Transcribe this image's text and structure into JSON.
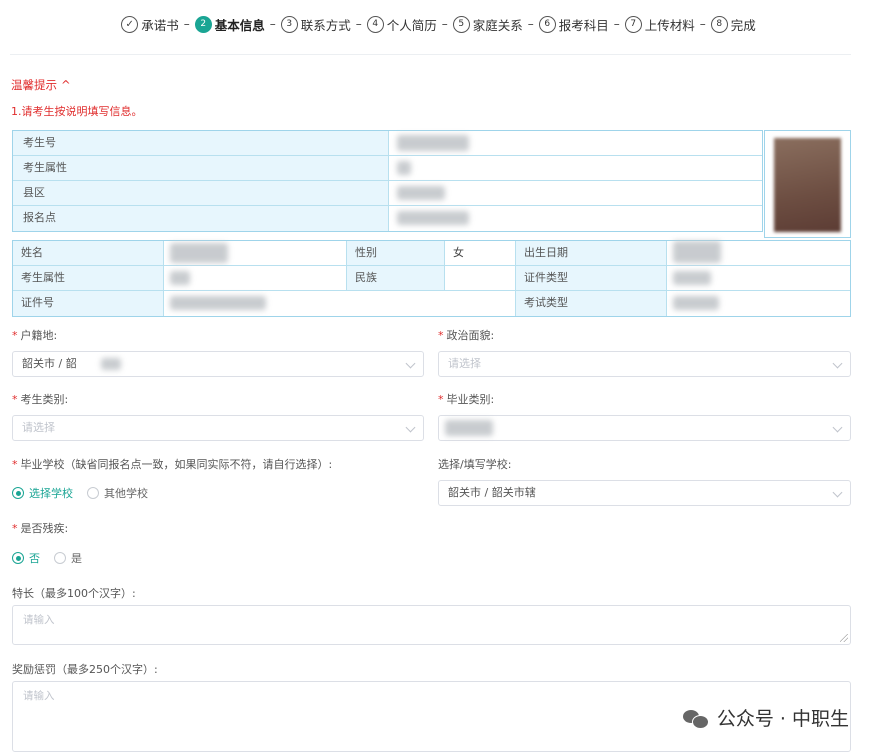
{
  "steps": [
    {
      "label": "承诺书",
      "state": "done",
      "mark": "✓"
    },
    {
      "label": "基本信息",
      "state": "active",
      "mark": "2"
    },
    {
      "label": "联系方式",
      "state": "todo",
      "mark": "3"
    },
    {
      "label": "个人简历",
      "state": "todo",
      "mark": "4"
    },
    {
      "label": "家庭关系",
      "state": "todo",
      "mark": "5"
    },
    {
      "label": "报考科目",
      "state": "todo",
      "mark": "6"
    },
    {
      "label": "上传材料",
      "state": "todo",
      "mark": "7"
    },
    {
      "label": "完成",
      "state": "todo",
      "mark": "8"
    }
  ],
  "step_separator": "–",
  "tips": {
    "title": "温馨提示",
    "toggle_icon": "^",
    "text": "1.请考生按说明填写信息。"
  },
  "info_table_1": {
    "rows": [
      "考生号",
      "考生属性",
      "县区",
      "报名点"
    ]
  },
  "info_table_2": {
    "name_label": "姓名",
    "gender_label": "性别",
    "gender_value": "女",
    "birth_label": "出生日期",
    "attr_label": "考生属性",
    "ethnic_label": "民族",
    "idtype_label": "证件类型",
    "idno_label": "证件号",
    "examtype_label": "考试类型"
  },
  "form": {
    "required_mark": "*",
    "hukou_label": "户籍地:",
    "hukou_value": "韶关市 / 韶",
    "politics_label": "政治面貌:",
    "politics_placeholder": "请选择",
    "category_label": "考生类别:",
    "category_placeholder": "请选择",
    "grad_category_label": "毕业类别:",
    "grad_school_label": "毕业学校（缺省同报名点一致，如果同实际不符，请自行选择）:",
    "school_option_select": "选择学校",
    "school_option_other": "其他学校",
    "select_school_label": "选择/填写学校:",
    "select_school_value": "韶关市 / 韶关市辖",
    "disabled_label": "是否残疾:",
    "disabled_no": "否",
    "disabled_yes": "是",
    "specialty_label": "特长（最多100个汉字）:",
    "specialty_placeholder": "请输入",
    "awards_label": "奖励惩罚（最多250个汉字）:",
    "awards_placeholder": "请输入"
  },
  "watermark": {
    "text": "公众号 · 中职生",
    "icon": "wechat-icon"
  },
  "colors": {
    "accent": "#1aa594",
    "tip_red": "#e02d2d",
    "table_header_bg": "#e7f6fd",
    "table_border": "#9fd4ea"
  }
}
